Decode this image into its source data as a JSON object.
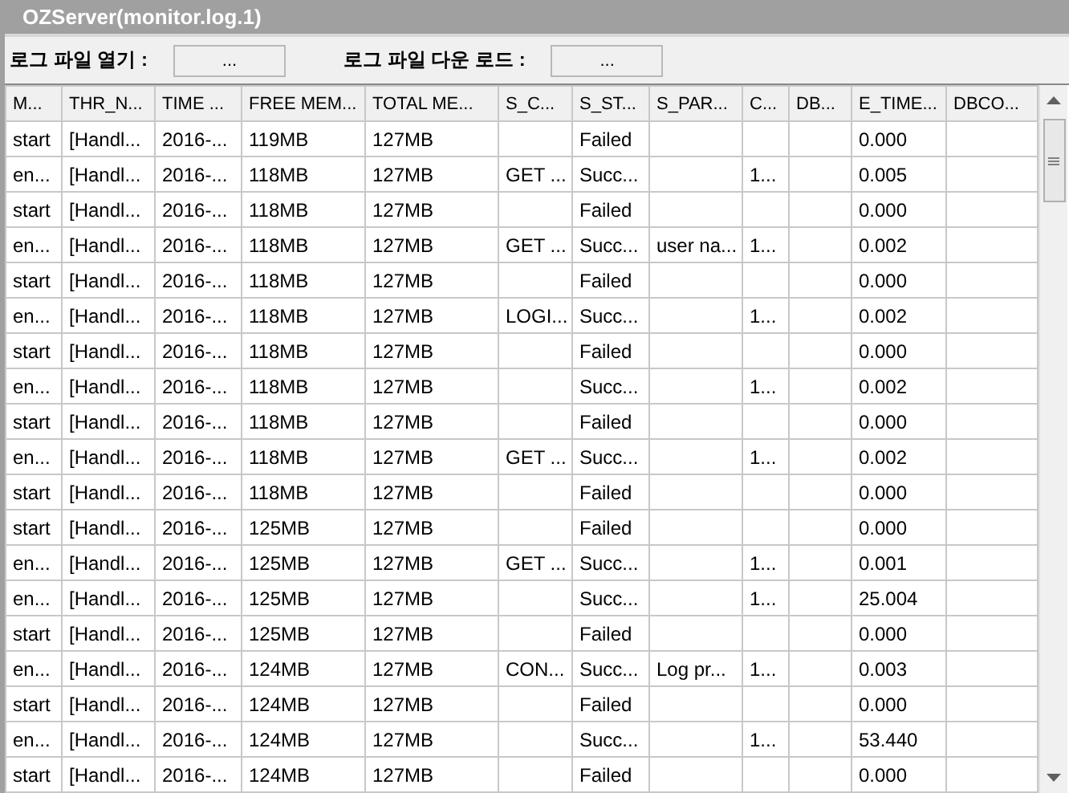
{
  "window": {
    "title": "OZServer(monitor.log.1)"
  },
  "toolbar": [
    {
      "label": "로그 파일 열기 :",
      "button": "..."
    },
    {
      "label": "로그 파일 다운 로드 :",
      "button": "..."
    }
  ],
  "table": {
    "columns": [
      "M...",
      "THR_N...",
      "TIME ...",
      "FREE MEM...",
      "TOTAL ME...",
      "S_C...",
      "S_ST...",
      "S_PAR...",
      "C...",
      "DB...",
      "E_TIME...",
      "DBCO..."
    ],
    "rows": [
      [
        "start",
        "[Handl...",
        "2016-...",
        "119MB",
        "127MB",
        null,
        "Failed",
        null,
        null,
        null,
        "0.000",
        null
      ],
      [
        "en...",
        "[Handl...",
        "2016-...",
        "118MB",
        "127MB",
        "GET ...",
        "Succ...",
        null,
        "1...",
        null,
        "0.005",
        null
      ],
      [
        "start",
        "[Handl...",
        "2016-...",
        "118MB",
        "127MB",
        null,
        "Failed",
        null,
        null,
        null,
        "0.000",
        null
      ],
      [
        "en...",
        "[Handl...",
        "2016-...",
        "118MB",
        "127MB",
        "GET ...",
        "Succ...",
        "user na...",
        "1...",
        null,
        "0.002",
        null
      ],
      [
        "start",
        "[Handl...",
        "2016-...",
        "118MB",
        "127MB",
        null,
        "Failed",
        null,
        null,
        null,
        "0.000",
        null
      ],
      [
        "en...",
        "[Handl...",
        "2016-...",
        "118MB",
        "127MB",
        "LOGI...",
        "Succ...",
        null,
        "1...",
        null,
        "0.002",
        null
      ],
      [
        "start",
        "[Handl...",
        "2016-...",
        "118MB",
        "127MB",
        null,
        "Failed",
        null,
        null,
        null,
        "0.000",
        null
      ],
      [
        "en...",
        "[Handl...",
        "2016-...",
        "118MB",
        "127MB",
        null,
        "Succ...",
        null,
        "1...",
        null,
        "0.002",
        null
      ],
      [
        "start",
        "[Handl...",
        "2016-...",
        "118MB",
        "127MB",
        null,
        "Failed",
        null,
        null,
        null,
        "0.000",
        null
      ],
      [
        "en...",
        "[Handl...",
        "2016-...",
        "118MB",
        "127MB",
        "GET ...",
        "Succ...",
        null,
        "1...",
        null,
        "0.002",
        null
      ],
      [
        "start",
        "[Handl...",
        "2016-...",
        "118MB",
        "127MB",
        null,
        "Failed",
        null,
        null,
        null,
        "0.000",
        null
      ],
      [
        "start",
        "[Handl...",
        "2016-...",
        "125MB",
        "127MB",
        null,
        "Failed",
        null,
        null,
        null,
        "0.000",
        null
      ],
      [
        "en...",
        "[Handl...",
        "2016-...",
        "125MB",
        "127MB",
        "GET ...",
        "Succ...",
        null,
        "1...",
        null,
        "0.001",
        null
      ],
      [
        "en...",
        "[Handl...",
        "2016-...",
        "125MB",
        "127MB",
        null,
        "Succ...",
        null,
        "1...",
        null,
        "25.004",
        null
      ],
      [
        "start",
        "[Handl...",
        "2016-...",
        "125MB",
        "127MB",
        null,
        "Failed",
        null,
        null,
        null,
        "0.000",
        null
      ],
      [
        "en...",
        "[Handl...",
        "2016-...",
        "124MB",
        "127MB",
        "CON...",
        "Succ...",
        "Log pr...",
        "1...",
        null,
        "0.003",
        null
      ],
      [
        "start",
        "[Handl...",
        "2016-...",
        "124MB",
        "127MB",
        null,
        "Failed",
        null,
        null,
        null,
        "0.000",
        null
      ],
      [
        "en...",
        "[Handl...",
        "2016-...",
        "124MB",
        "127MB",
        null,
        "Succ...",
        null,
        "1...",
        null,
        "53.440",
        null
      ],
      [
        "start",
        "[Handl...",
        "2016-...",
        "124MB",
        "127MB",
        null,
        "Failed",
        null,
        null,
        null,
        "0.000",
        null
      ]
    ]
  }
}
